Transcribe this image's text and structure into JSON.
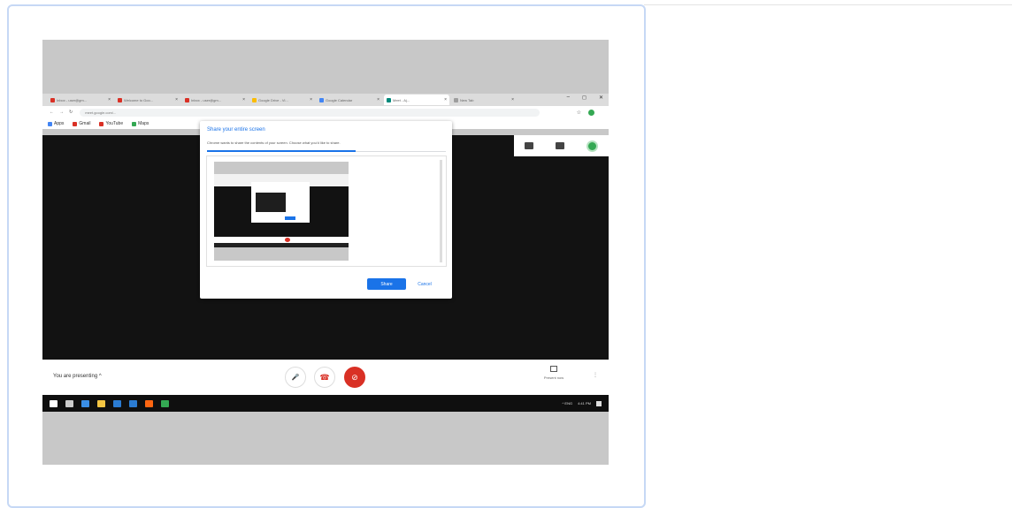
{
  "browser": {
    "tabs": [
      {
        "label": "Inbox - user@gm...",
        "icon": "gmail-icon",
        "color": "#d93025",
        "active": false
      },
      {
        "label": "Welcome to Goo...",
        "icon": "gmail-icon",
        "color": "#d93025",
        "active": false
      },
      {
        "label": "Inbox - user@gm...",
        "icon": "gmail-icon",
        "color": "#d93025",
        "active": false
      },
      {
        "label": "Google Drive - Vi...",
        "icon": "drive-icon",
        "color": "#fbbc04",
        "active": false
      },
      {
        "label": "Google Calendar",
        "icon": "calendar-icon",
        "color": "#4285f4",
        "active": false
      },
      {
        "label": "Meet - Aj...",
        "icon": "meet-icon",
        "color": "#00897b",
        "active": true
      },
      {
        "label": "New Tab",
        "icon": "tab-icon",
        "color": "#9e9e9e",
        "active": false
      }
    ],
    "window_controls": [
      "–",
      "◻",
      "✕"
    ],
    "address": "meet.google.com/...",
    "bookmarks": [
      {
        "label": "Apps",
        "color": "#4285f4"
      },
      {
        "label": "Gmail",
        "color": "#d93025"
      },
      {
        "label": "YouTube",
        "color": "#d93025"
      },
      {
        "label": "Maps",
        "color": "#34a853"
      }
    ]
  },
  "dialog": {
    "title": "Share your entire screen",
    "description": "Chrome wants to share the contents of your screen. Choose what you'd like to share.",
    "share_label": "Share",
    "cancel_label": "Cancel"
  },
  "callbar": {
    "presenting_text": "You are presenting",
    "mic_icon": "🎤",
    "hangup_icon": "☎",
    "camera_icon": "⊘",
    "present_now": "Present now",
    "more": "⋮"
  },
  "taskbar": {
    "apps": [
      {
        "icon": "start-icon",
        "color": "#ffffff"
      },
      {
        "icon": "task-view-icon",
        "color": "#cccccc"
      },
      {
        "icon": "edge-icon",
        "color": "#3a8ee6"
      },
      {
        "icon": "file-explorer-icon",
        "color": "#f4c542"
      },
      {
        "icon": "mail-icon",
        "color": "#2b7cd3"
      },
      {
        "icon": "store-icon",
        "color": "#2b7cd3"
      },
      {
        "icon": "firefox-icon",
        "color": "#ff6611"
      },
      {
        "icon": "chrome-icon",
        "color": "#34a853"
      }
    ],
    "tray_text": "^ ENG",
    "time": "4:41 PM"
  }
}
